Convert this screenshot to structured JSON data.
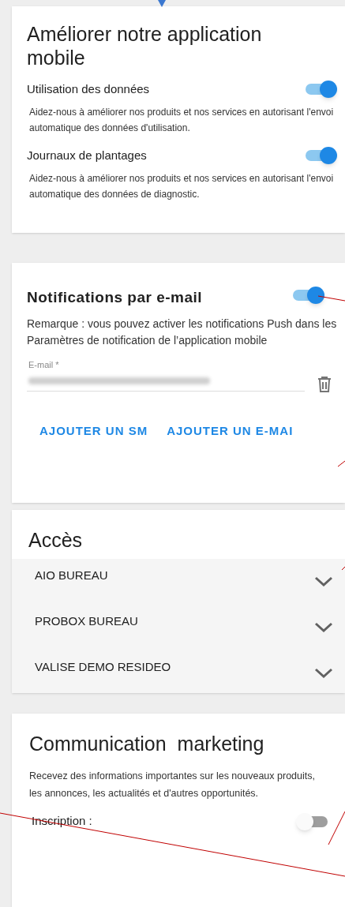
{
  "improve_app": {
    "title": "Améliorer notre application mobile",
    "settings": [
      {
        "label": "Utilisation des données",
        "on": true,
        "description": "Aidez-nous à améliorer nos produits et nos services en autorisant l'envoi automatique des données d'utilisation."
      },
      {
        "label": "Journaux de plantages",
        "on": true,
        "description": "Aidez-nous à améliorer nos produits et nos services en autorisant l'envoi automatique des données de diagnostic."
      }
    ]
  },
  "email_notifications": {
    "title": "Notifications par e-mail",
    "on": true,
    "note": "Remarque : vous pouvez activer les notifications Push dans les Paramètres de notification de l’application mobile",
    "email_label": "E-mail *",
    "buttons": [
      "AJOUTER UN SM",
      "AJOUTER UN E-MAI"
    ]
  },
  "access": {
    "title": "Accès",
    "items": [
      {
        "label": "AIO BUREAU",
        "expanded": false
      },
      {
        "label": "PROBOX BUREAU",
        "expanded": false
      },
      {
        "label": "VALISE DEMO RESIDEO",
        "expanded": false
      }
    ]
  },
  "marketing": {
    "title": "Communication  marketing",
    "description": "Recevez des informations importantes sur les nouveaux produits, les annonces, les actualités et d'autres opportunités.",
    "subscribe_label": "Inscription :",
    "on": false
  }
}
